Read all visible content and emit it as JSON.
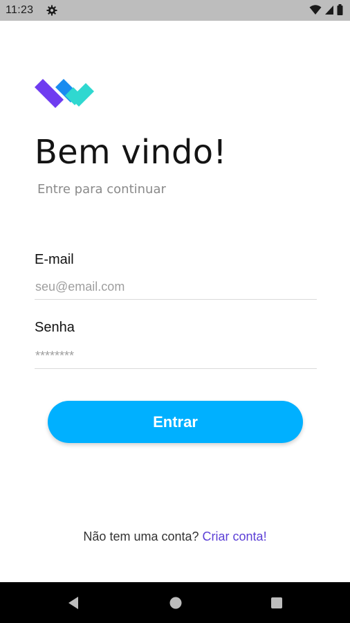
{
  "status_bar": {
    "time": "11:23",
    "icons": [
      "settings-gear-icon",
      "wifi-icon",
      "cellular-signal-icon",
      "battery-icon"
    ]
  },
  "app": {
    "logo": "app-logo",
    "title": "Bem vindo!",
    "subtitle": "Entre para continuar",
    "email": {
      "label": "E-mail",
      "placeholder": "seu@email.com",
      "value": ""
    },
    "password": {
      "label": "Senha",
      "placeholder": "********",
      "value": ""
    },
    "submit_label": "Entrar",
    "signup_prompt": "Não tem uma conta?",
    "signup_link": "Criar conta!"
  },
  "colors": {
    "primary_button": "#00b0ff",
    "link": "#5b3fd6",
    "logo_purple": "#6f3cf0",
    "logo_blue": "#1a8cf0",
    "logo_cyan": "#2fd8d0"
  },
  "nav_bar": {
    "icons": [
      "back-icon",
      "home-icon",
      "recents-icon"
    ]
  }
}
